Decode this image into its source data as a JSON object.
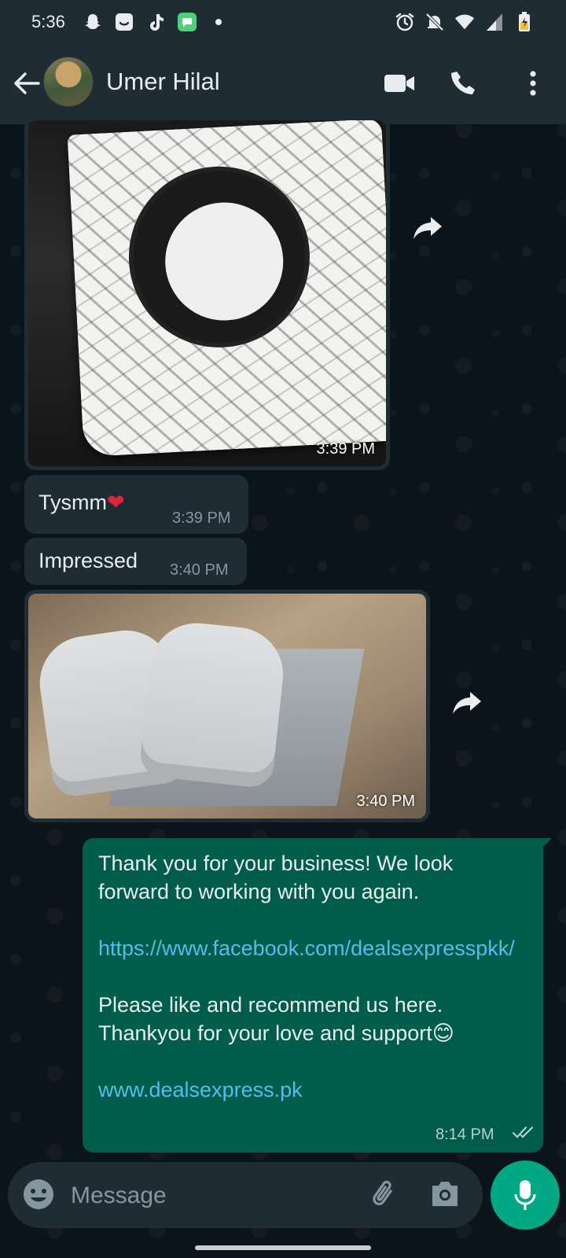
{
  "status_bar": {
    "time": "5:36",
    "left_icons": [
      "snapchat-icon",
      "smile-box-icon",
      "tiktok-icon",
      "chat-app-icon",
      "dot-icon"
    ],
    "right_icons": [
      "alarm-icon",
      "bell-off-icon",
      "wifi-icon",
      "signal-icon",
      "battery-charging-icon"
    ]
  },
  "header": {
    "contact_name": "Umer Hilal",
    "icons": [
      "back-arrow-icon",
      "video-call-icon",
      "phone-icon",
      "more-vert-icon"
    ]
  },
  "messages": [
    {
      "type": "image",
      "direction": "incoming",
      "subject": "packaging-bag",
      "time": "3:39 PM"
    },
    {
      "type": "text",
      "direction": "incoming",
      "text": "Tysmm",
      "emoji": "heart",
      "time": "3:39 PM"
    },
    {
      "type": "text",
      "direction": "incoming",
      "text": "Impressed",
      "time": "3:40 PM"
    },
    {
      "type": "image",
      "direction": "incoming",
      "subject": "sneakers",
      "time": "3:40 PM"
    },
    {
      "type": "text",
      "direction": "outgoing",
      "line1": "Thank you for your business! We look forward to working with you again.",
      "link1": "https://www.facebook.com/dealsexpresspkk/",
      "line2": "Please like and recommend us here. Thankyou for your love and support",
      "emoji": "smile",
      "link2": "www.dealsexpress.pk",
      "time": "8:14 PM",
      "status": "read"
    }
  ],
  "input": {
    "placeholder": "Message",
    "icons": [
      "emoji-icon",
      "attach-icon",
      "camera-icon",
      "mic-icon"
    ]
  },
  "colors": {
    "header_bg": "#1f2c34",
    "chat_bg": "#0b141a",
    "incoming_bubble": "#1f2c34",
    "outgoing_bubble": "#005c4b",
    "link": "#53bdeb",
    "accent": "#00a884"
  }
}
